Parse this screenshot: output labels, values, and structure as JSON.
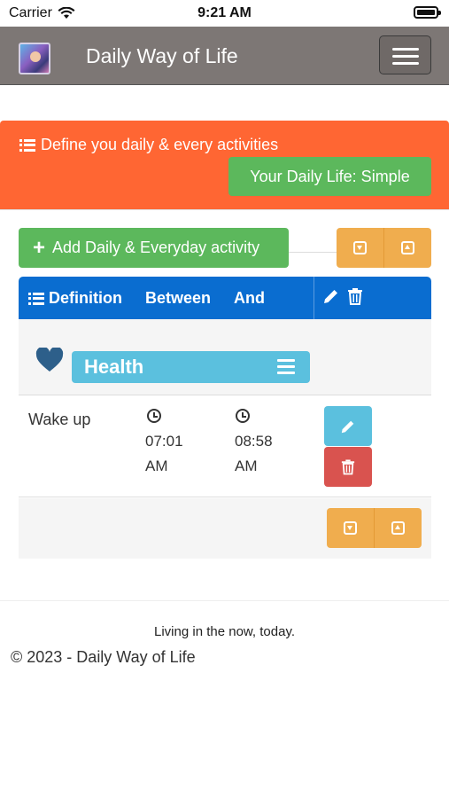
{
  "status_bar": {
    "carrier": "Carrier",
    "time": "9:21 AM"
  },
  "navbar": {
    "brand": "Daily Way of Life",
    "menu_icon": "hamburger-icon"
  },
  "banner": {
    "title": "Define you daily & every activities",
    "style_button": "Your Daily Life: Simple",
    "color": "#ff6633"
  },
  "toolbar": {
    "add_label": "Add Daily & Everyday activity"
  },
  "table": {
    "headers": {
      "definition": "Definition",
      "between": "Between",
      "and": "And"
    },
    "category": {
      "name": "Health",
      "icon": "heart-icon"
    },
    "rows": [
      {
        "name": "Wake up",
        "between_time": "07:01",
        "between_ampm": "AM",
        "and_time": "08:58",
        "and_ampm": "AM"
      }
    ]
  },
  "footer": {
    "tagline": "Living in the now, today.",
    "copyright": "© 2023 - Daily Way of Life"
  },
  "colors": {
    "navbar": "#7d7775",
    "success": "#5cb85c",
    "primary": "#0a6dd0",
    "info": "#5bc0de",
    "warning": "#f0ad4e",
    "danger": "#d9534f",
    "heart": "#2d5f8a"
  }
}
